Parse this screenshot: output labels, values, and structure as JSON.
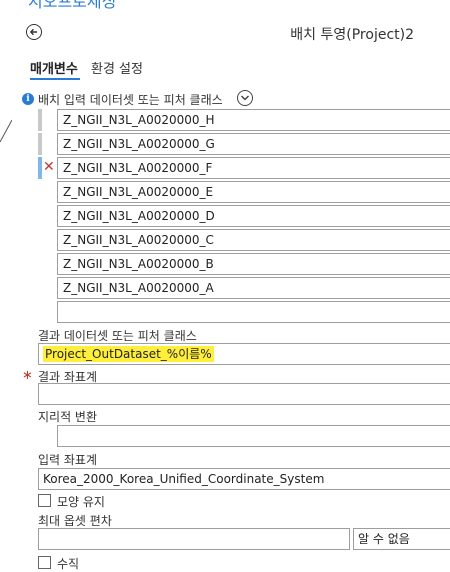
{
  "panel": {
    "title": "지오프로세싱"
  },
  "tool": {
    "title": "배치 투영(Project)2"
  },
  "tabs": [
    {
      "label": "매개변수"
    },
    {
      "label": "환경 설정"
    }
  ],
  "params": {
    "input_label": "배치 입력 데이터셋 또는 피처 클래스",
    "input_items": [
      "Z_NGII_N3L_A0020000_H",
      "Z_NGII_N3L_A0020000_G",
      "Z_NGII_N3L_A0020000_F",
      "Z_NGII_N3L_A0020000_E",
      "Z_NGII_N3L_A0020000_D",
      "Z_NGII_N3L_A0020000_C",
      "Z_NGII_N3L_A0020000_B",
      "Z_NGII_N3L_A0020000_A"
    ],
    "output_label": "결과 데이터셋 또는 피처 클래스",
    "output_value": "Project_OutDataset_%이름%",
    "out_cs_label": "결과 좌표계",
    "out_cs_value": "",
    "geo_transform_label": "지리적 변환",
    "geo_transform_value": "",
    "in_cs_label": "입력 좌표계",
    "in_cs_value": "Korea_2000_Korea_Unified_Coordinate_System",
    "preserve_shape_label": "모양 유지",
    "max_offset_label": "최대 옵셋 편차",
    "max_offset_value": "",
    "max_offset_unit": "알 수 없음",
    "vertical_label": "수직"
  }
}
